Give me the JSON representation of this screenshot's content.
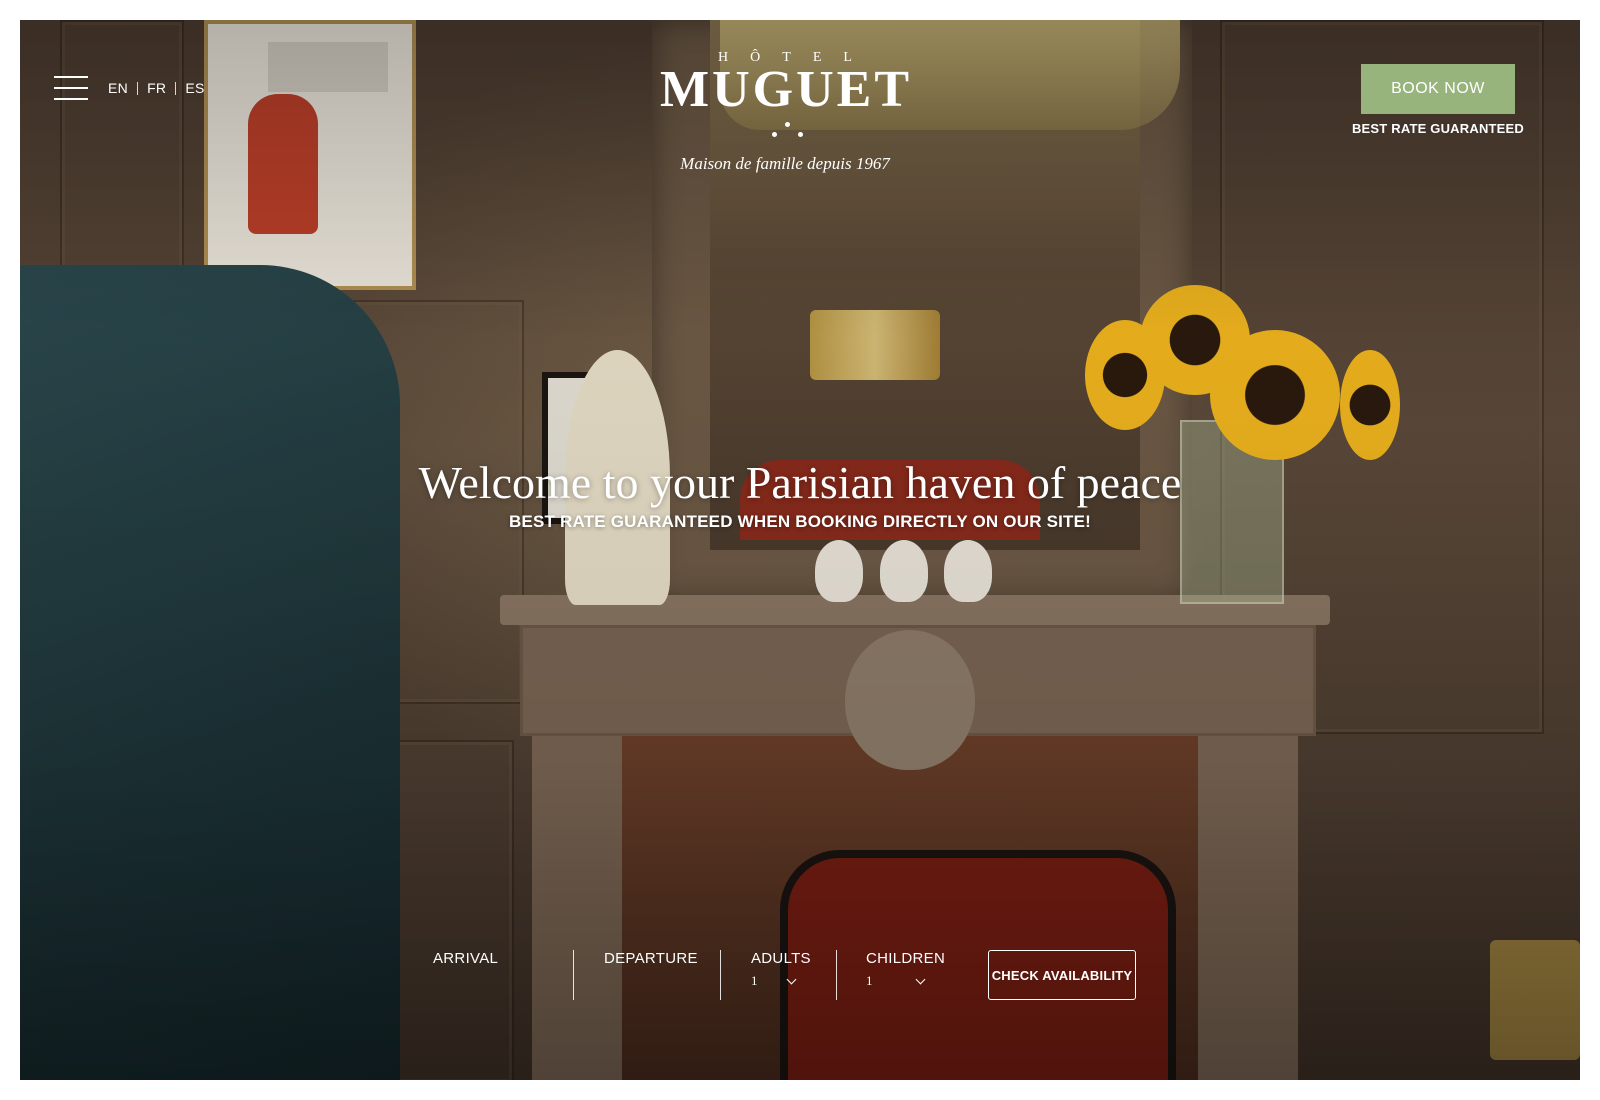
{
  "header": {
    "languages": [
      "EN",
      "FR",
      "ES"
    ],
    "logo": {
      "prefix": "HÔTEL",
      "name": "MUGUET",
      "tagline": "Maison de famille depuis 1967"
    },
    "book_now_label": "BOOK NOW",
    "best_rate_label": "BEST RATE GUARANTEED",
    "accent_color": "#97b47c"
  },
  "hero": {
    "headline": "Welcome to your Parisian haven of peace",
    "subheadline": "BEST RATE GUARANTEED WHEN BOOKING DIRECTLY ON OUR SITE!"
  },
  "booking": {
    "arrival_label": "ARRIVAL",
    "departure_label": "DEPARTURE",
    "adults_label": "ADULTS",
    "adults_value": "1",
    "children_label": "CHILDREN",
    "children_value": "1",
    "check_label": "CHECK AVAILABILITY"
  },
  "icons": {
    "menu": "hamburger-menu-icon",
    "dropdown": "chevron-down-icon"
  }
}
